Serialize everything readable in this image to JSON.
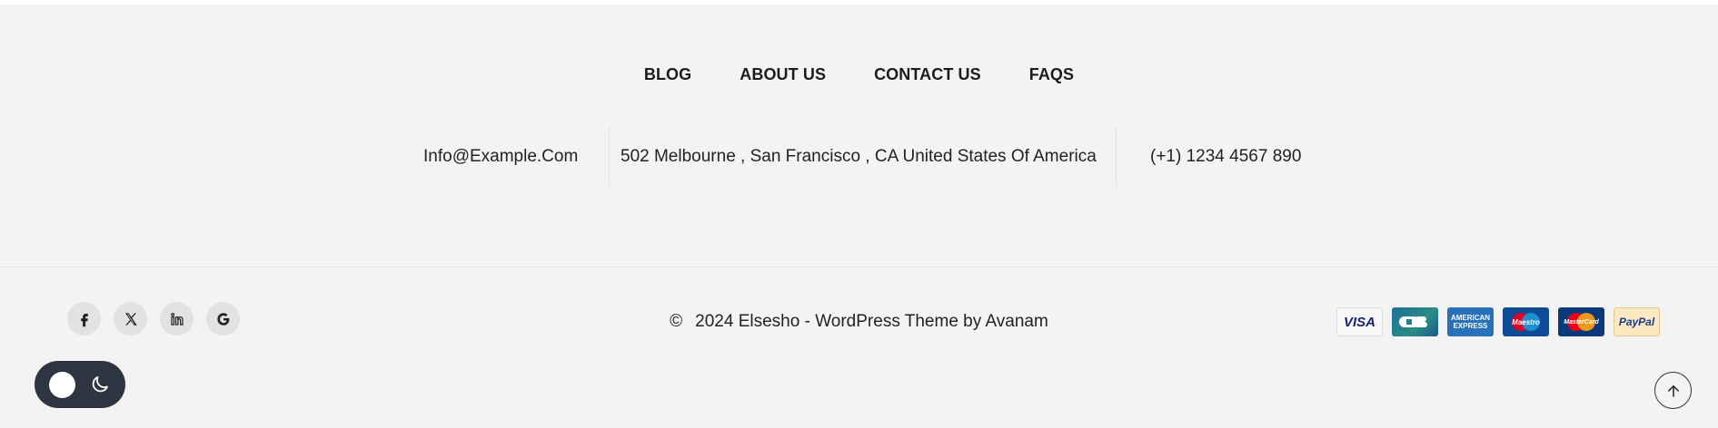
{
  "nav": {
    "items": [
      {
        "label": "BLOG"
      },
      {
        "label": "ABOUT US"
      },
      {
        "label": "CONTACT US"
      },
      {
        "label": "FAQS"
      }
    ]
  },
  "contact": {
    "email": "Info@Example.Com",
    "address": "502 Melbourne , San Francisco , CA United States Of America",
    "phone": "(+1) 1234 4567 890"
  },
  "social": {
    "icons": [
      "facebook-icon",
      "x-icon",
      "linkedin-icon",
      "google-icon"
    ]
  },
  "copyright": {
    "symbol": "©",
    "text": "2024 Elsesho - WordPress Theme by Avanam"
  },
  "payments": {
    "cards": [
      "visa",
      "cb",
      "american-express",
      "maestro",
      "mastercard",
      "paypal"
    ],
    "visa_text": "VISA",
    "amex_line1": "AMERICAN",
    "amex_line2": "EXPRESS",
    "maestro_text": "Maestro",
    "mastercard_text": "MasterCard",
    "paypal_text": "PayPal"
  },
  "colors": {
    "background": "#f3f3f3",
    "toggle_bg": "#2e3441",
    "social_bg": "#e2e2e2"
  },
  "theme_toggle": {
    "state": "light"
  }
}
